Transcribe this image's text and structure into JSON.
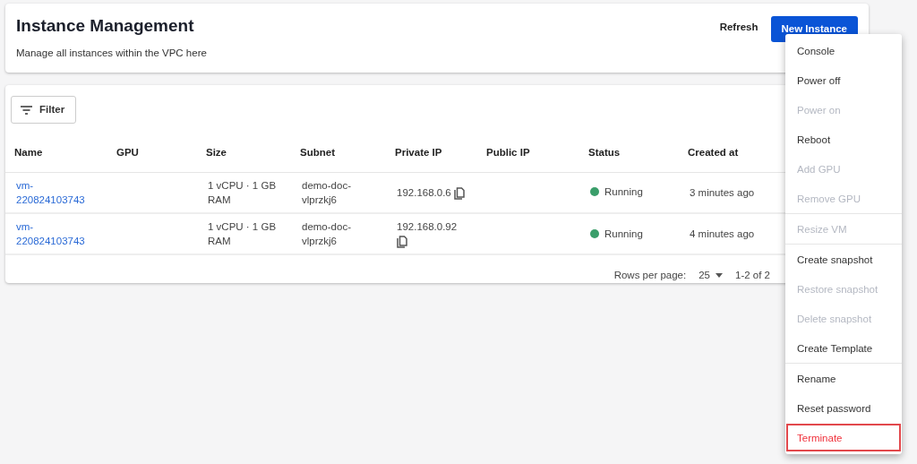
{
  "header": {
    "title": "Instance Management",
    "subtitle": "Manage all instances within the VPC here",
    "buttons": [
      {
        "label": "Refresh",
        "kind": "text"
      },
      {
        "label": "New Instance",
        "kind": "primary"
      }
    ]
  },
  "filter": {
    "label": "Filter"
  },
  "table": {
    "columns": [
      "Name",
      "GPU",
      "Size",
      "Subnet",
      "Private IP",
      "Public IP",
      "Status",
      "Created at"
    ],
    "rows": [
      {
        "name": "vm-\n220824103743",
        "gpu": "",
        "size": "1 vCPU · 1 GB RAM",
        "subnet": "demo-doc-vlprzkj6",
        "private_ip": "192.168.0.6",
        "status": "Running",
        "color": "#3a9e6a",
        "created": "3 minutes ago"
      },
      {
        "name": "vm-\n220824103743",
        "gpu": "",
        "size": "1 vCPU · 1 GB RAM",
        "subnet": "demo-doc-vlprzkj6",
        "private_ip": "192.168.0.92",
        "status": "Running",
        "color": "#3a9e6a",
        "created": "4 minutes ago"
      }
    ]
  },
  "pagination": {
    "rows_label": "Rows per page:",
    "rows_value": "25",
    "range": "1-2 of 2"
  },
  "menu": {
    "sections": [
      [
        {
          "label": "Console",
          "disabled": false,
          "kind": "normal",
          "highlighted": false
        },
        {
          "label": "Power off",
          "disabled": false,
          "kind": "normal",
          "highlighted": false
        },
        {
          "label": "Power on",
          "disabled": true,
          "kind": "normal",
          "highlighted": false
        },
        {
          "label": "Reboot",
          "disabled": false,
          "kind": "normal",
          "highlighted": false
        },
        {
          "label": "Add GPU",
          "disabled": true,
          "kind": "normal",
          "highlighted": false
        },
        {
          "label": "Remove GPU",
          "disabled": true,
          "kind": "normal",
          "highlighted": false
        }
      ],
      [
        {
          "label": "Resize VM",
          "disabled": true,
          "kind": "normal",
          "highlighted": false
        }
      ],
      [
        {
          "label": "Create snapshot",
          "disabled": false,
          "kind": "normal",
          "highlighted": false
        },
        {
          "label": "Restore snapshot",
          "disabled": true,
          "kind": "normal",
          "highlighted": false
        },
        {
          "label": "Delete snapshot",
          "disabled": true,
          "kind": "normal",
          "highlighted": false
        },
        {
          "label": "Create Template",
          "disabled": false,
          "kind": "normal",
          "highlighted": false
        }
      ],
      [
        {
          "label": "Rename",
          "disabled": false,
          "kind": "normal",
          "highlighted": false
        },
        {
          "label": "Reset password",
          "disabled": false,
          "kind": "normal",
          "highlighted": false
        },
        {
          "label": "Terminate",
          "disabled": false,
          "kind": "danger",
          "highlighted": true
        }
      ]
    ]
  }
}
